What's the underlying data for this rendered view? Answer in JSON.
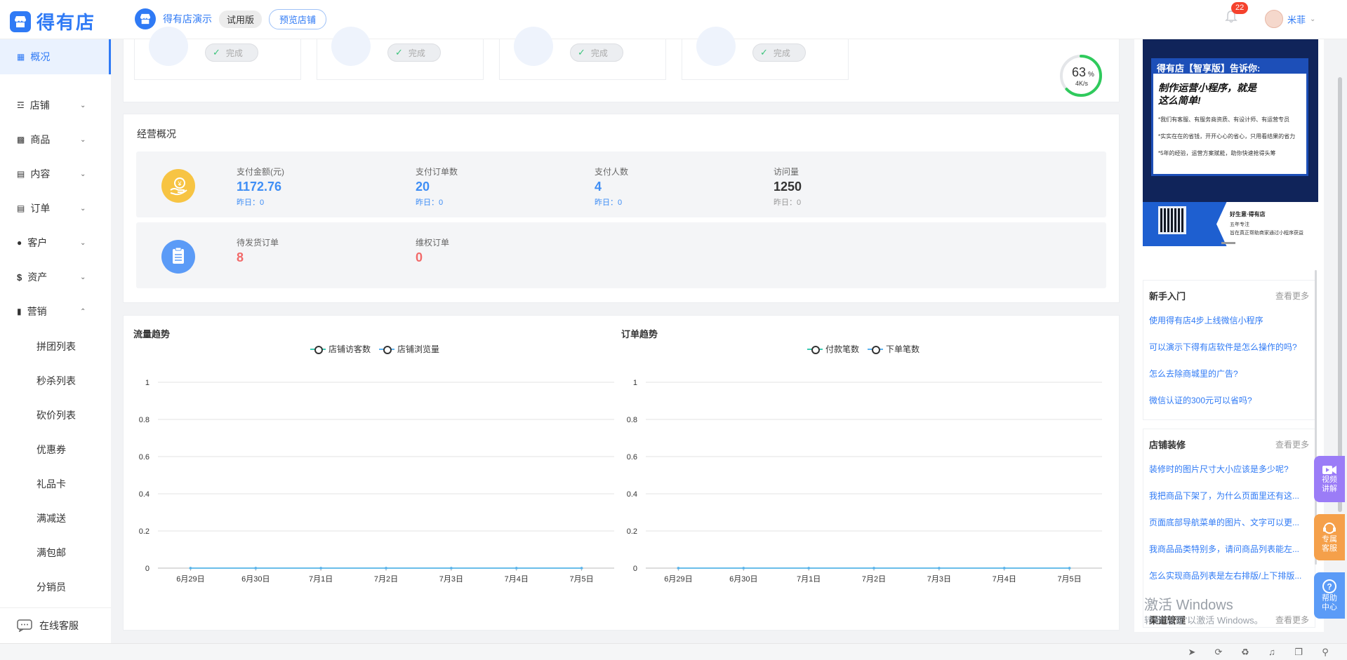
{
  "app": {
    "logo_text": "得有店",
    "store_name": "得有店演示",
    "trial_label": "试用版",
    "preview_button": "预览店铺",
    "notification_count": "22",
    "user_name": "米菲"
  },
  "sidebar": {
    "active_item": "概况",
    "items": [
      {
        "label": "店铺",
        "icon": "store-icon"
      },
      {
        "label": "商品",
        "icon": "goods-icon"
      },
      {
        "label": "内容",
        "icon": "content-icon"
      },
      {
        "label": "订单",
        "icon": "order-icon"
      },
      {
        "label": "客户",
        "icon": "customer-icon"
      },
      {
        "label": "资产",
        "icon": "asset-icon"
      },
      {
        "label": "营销",
        "icon": "marketing-icon",
        "expanded": true
      }
    ],
    "marketing_sub": [
      "拼团列表",
      "秒杀列表",
      "砍价列表",
      "优惠券",
      "礼品卡",
      "满减送",
      "满包邮",
      "分销员"
    ],
    "online_service": "在线客服"
  },
  "tasks": {
    "done_label": "完成",
    "progress_percent": 63,
    "progress_text": "63",
    "progress_unit": "%",
    "speed": "4K/s"
  },
  "overview": {
    "title": "经营概况",
    "row1": [
      {
        "label": "支付金额(元)",
        "value": "1172.76",
        "yesterday": "昨日：0"
      },
      {
        "label": "支付订单数",
        "value": "20",
        "yesterday": "昨日：0"
      },
      {
        "label": "支付人数",
        "value": "4",
        "yesterday": "昨日：0"
      },
      {
        "label": "访问量",
        "value": "1250",
        "yesterday": "昨日：0"
      }
    ],
    "row2": [
      {
        "label": "待发货订单",
        "value": "8"
      },
      {
        "label": "维权订单",
        "value": "0"
      }
    ]
  },
  "chart_data": [
    {
      "type": "line",
      "title": "流量趋势",
      "categories": [
        "6月29日",
        "6月30日",
        "7月1日",
        "7月2日",
        "7月3日",
        "7月4日",
        "7月5日"
      ],
      "series": [
        {
          "name": "店铺访客数",
          "values": [
            0,
            0,
            0,
            0,
            0,
            0,
            0
          ],
          "color": "#3bc9b0"
        },
        {
          "name": "店铺浏览量",
          "values": [
            0,
            0,
            0,
            0,
            0,
            0,
            0
          ],
          "color": "#5ab1ef"
        }
      ],
      "ylim": [
        0,
        1
      ],
      "yticks": [
        "0",
        "0.2",
        "0.4",
        "0.6",
        "0.8",
        "1"
      ],
      "grid": true,
      "legend": "top-center"
    },
    {
      "type": "line",
      "title": "订单趋势",
      "categories": [
        "6月29日",
        "6月30日",
        "7月1日",
        "7月2日",
        "7月3日",
        "7月4日",
        "7月5日"
      ],
      "series": [
        {
          "name": "付款笔数",
          "values": [
            0,
            0,
            0,
            0,
            0,
            0,
            0
          ],
          "color": "#3bc9b0"
        },
        {
          "name": "下单笔数",
          "values": [
            0,
            0,
            0,
            0,
            0,
            0,
            0
          ],
          "color": "#5ab1ef"
        }
      ],
      "ylim": [
        0,
        1
      ],
      "yticks": [
        "0",
        "0.2",
        "0.4",
        "0.6",
        "0.8",
        "1"
      ],
      "grid": true,
      "legend": "top-center"
    }
  ],
  "banner": {
    "heading": "得有店【智享版】告诉你:",
    "title": "制作运营小程序，就是这么简单!",
    "bullets": [
      "*我们有客服、有服务商资质、有设计师、有运营专员",
      "*实实在在的省钱，开开心心的省心，只用看结果的省力",
      "*5年的经验，运营方案赋能，助你快速抢得头筹"
    ],
    "footer_name": "好生意·得有店",
    "footer_l1": "五年专注",
    "footer_l2": "旨在真正帮助商家通过小程序获益"
  },
  "help": {
    "more_label": "查看更多",
    "beginner": {
      "title": "新手入门",
      "links": [
        "使用得有店4步上线微信小程序",
        "可以演示下得有店软件是怎么操作的吗?",
        "怎么去除商城里的广告?",
        "微信认证的300元可以省吗?"
      ]
    },
    "decor": {
      "title": "店铺装修",
      "links": [
        "装修时的图片尺寸大小应该是多少呢?",
        "我把商品下架了，为什么页面里还有这...",
        "页面底部导航菜单的图片、文字可以更...",
        "我商品品类特别多，请问商品列表能左...",
        "怎么实现商品列表是左右排版/上下排版..."
      ]
    },
    "third_title": "渠道管理"
  },
  "float_buttons": [
    {
      "label1": "视频",
      "label2": "讲解",
      "color": "#9b7cf7",
      "icon": "video-icon"
    },
    {
      "label1": "专属",
      "label2": "客服",
      "color": "#f5a04a",
      "icon": "headset-icon"
    },
    {
      "label1": "帮助",
      "label2": "中心",
      "color": "#5b9bf7",
      "icon": "help-icon"
    }
  ],
  "watermark": {
    "line1": "激活 Windows",
    "line2": "转到\"设置\"以激活 Windows。"
  }
}
